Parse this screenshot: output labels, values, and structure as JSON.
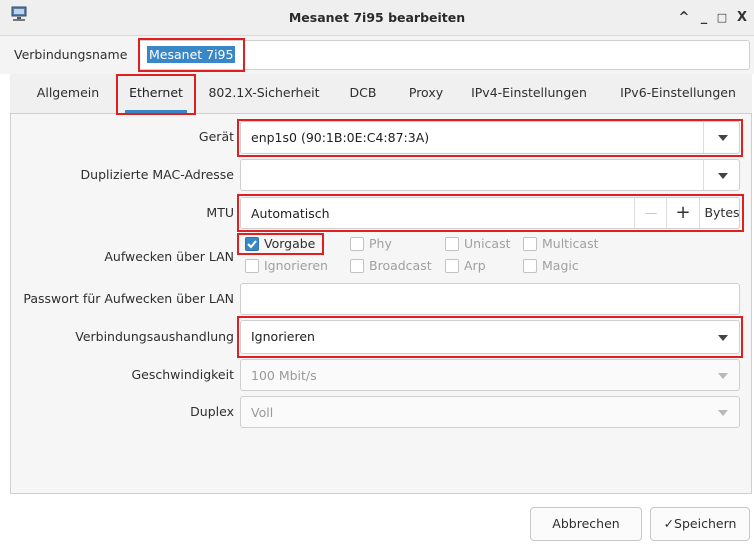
{
  "window": {
    "title": "Mesanet 7i95 bearbeiten",
    "controls": [
      "^",
      "_",
      "□",
      "X"
    ]
  },
  "connection_name": {
    "label": "Verbindungsname",
    "value": "Mesanet 7i95"
  },
  "tabs": [
    {
      "label": "Allgemein",
      "active": false
    },
    {
      "label": "Ethernet",
      "active": true
    },
    {
      "label": "802.1X-Sicherheit",
      "active": false
    },
    {
      "label": "DCB",
      "active": false
    },
    {
      "label": "Proxy",
      "active": false
    },
    {
      "label": "IPv4-Einstellungen",
      "active": false
    },
    {
      "label": "IPv6-Einstellungen",
      "active": false
    }
  ],
  "ethernet": {
    "device": {
      "label": "Gerät",
      "value": "enp1s0 (90:1B:0E:C4:87:3A)"
    },
    "cloned_mac": {
      "label": "Duplizierte MAC-Adresse",
      "value": ""
    },
    "mtu": {
      "label": "MTU",
      "value": "Automatisch",
      "minus": "—",
      "plus": "+",
      "unit": "Bytes"
    },
    "wake_on_lan": {
      "label": "Aufwecken über LAN",
      "options": [
        {
          "label": "Vorgabe",
          "checked": true
        },
        {
          "label": "Phy",
          "checked": false
        },
        {
          "label": "Unicast",
          "checked": false
        },
        {
          "label": "Multicast",
          "checked": false
        },
        {
          "label": "Ignorieren",
          "checked": false
        },
        {
          "label": "Broadcast",
          "checked": false
        },
        {
          "label": "Arp",
          "checked": false
        },
        {
          "label": "Magic",
          "checked": false
        }
      ]
    },
    "wol_password": {
      "label": "Passwort für Aufwecken über LAN",
      "value": ""
    },
    "negotiation": {
      "label": "Verbindungsaushandlung",
      "value": "Ignorieren"
    },
    "speed": {
      "label": "Geschwindigkeit",
      "value": "100 Mbit/s"
    },
    "duplex": {
      "label": "Duplex",
      "value": "Voll"
    }
  },
  "buttons": {
    "cancel": "Abbrechen",
    "save": "Speichern",
    "save_check": "✓"
  },
  "colors": {
    "accent": "#3a87c8",
    "highlight": "#e02020"
  }
}
